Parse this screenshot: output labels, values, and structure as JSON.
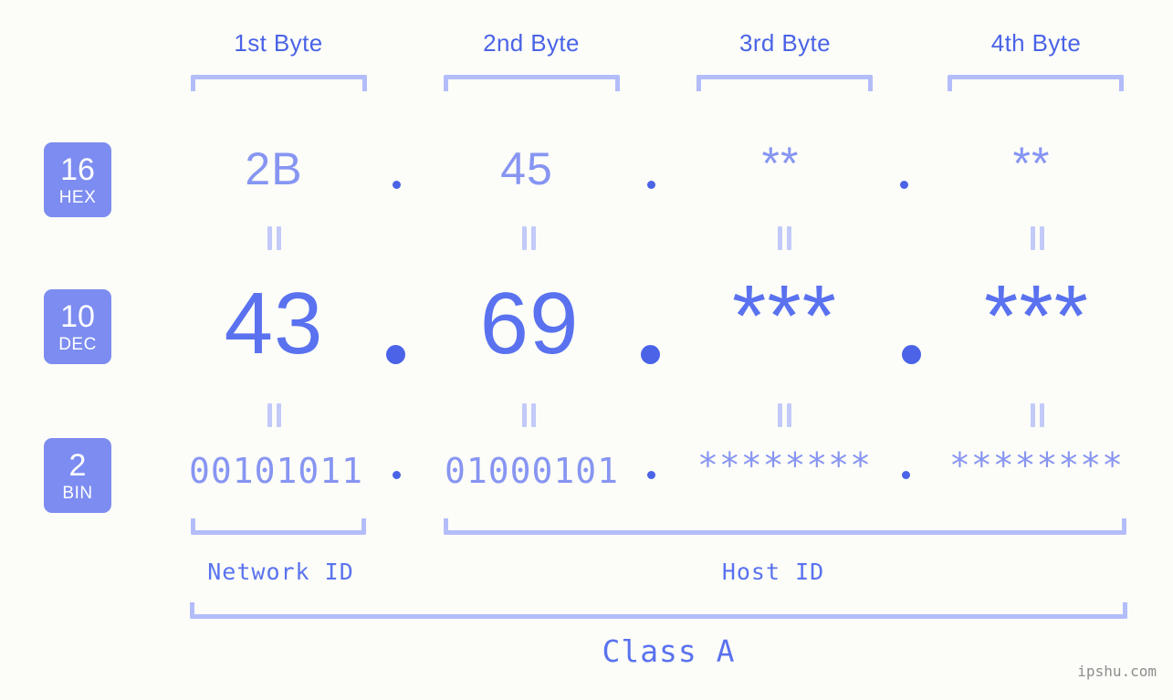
{
  "background_color": "#fcfdf8",
  "accent_color": "#5a72ef",
  "accent_light_color": "#8795f2",
  "bracket_color": "#b3bdfa",
  "badge_color": "#7c8cf0",
  "header": {
    "bytes": [
      {
        "label": "1st Byte"
      },
      {
        "label": "2nd Byte"
      },
      {
        "label": "3rd Byte"
      },
      {
        "label": "4th Byte"
      }
    ]
  },
  "rows": [
    {
      "badge_number": "16",
      "badge_abbr": "HEX",
      "values": [
        "2B",
        "45",
        "**",
        "**"
      ],
      "separator": "."
    },
    {
      "badge_number": "10",
      "badge_abbr": "DEC",
      "values": [
        "43",
        "69",
        "***",
        "***"
      ],
      "separator": "."
    },
    {
      "badge_number": "2",
      "badge_abbr": "BIN",
      "values": [
        "00101011",
        "01000101",
        "********",
        "********"
      ],
      "separator": "."
    }
  ],
  "equals_symbol": "=",
  "sections": [
    {
      "label": "Network ID"
    },
    {
      "label": "Host ID"
    }
  ],
  "class": {
    "label": "Class A"
  },
  "watermark": {
    "text": "ipshu.com"
  }
}
